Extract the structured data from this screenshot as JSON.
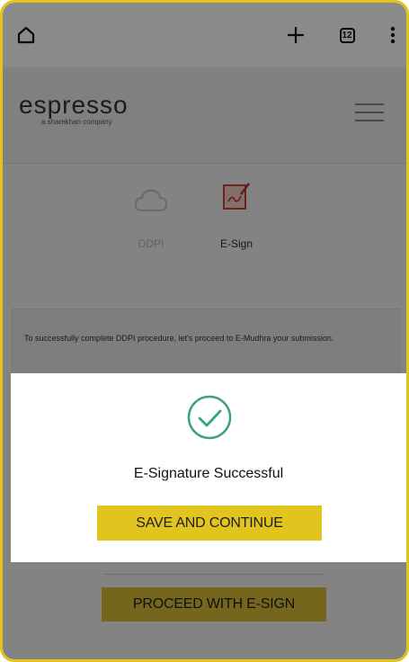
{
  "browser": {
    "tab_count": "12",
    "icons": [
      "home-icon",
      "plus-icon",
      "tabs-icon",
      "more-vert-icon"
    ]
  },
  "app": {
    "logo_text": "espresso",
    "logo_sub": "a sharekhan company"
  },
  "steps": [
    {
      "label": "DDPI",
      "state": "inactive",
      "icon": "cloud-icon"
    },
    {
      "label": "E-Sign",
      "state": "active",
      "icon": "esign-icon"
    }
  ],
  "info_text": "To successfully complete DDPI procedure, let's proceed to E-Mudhra your submission.",
  "proceed_button": "PROCEED WITH E-SIGN",
  "modal": {
    "title": "E-Signature Successful",
    "button": "SAVE AND CONTINUE",
    "icon": "check-circle-icon"
  },
  "colors": {
    "accent": "#e2c41f",
    "success": "#3aa37d",
    "frame": "#e3c21a"
  }
}
